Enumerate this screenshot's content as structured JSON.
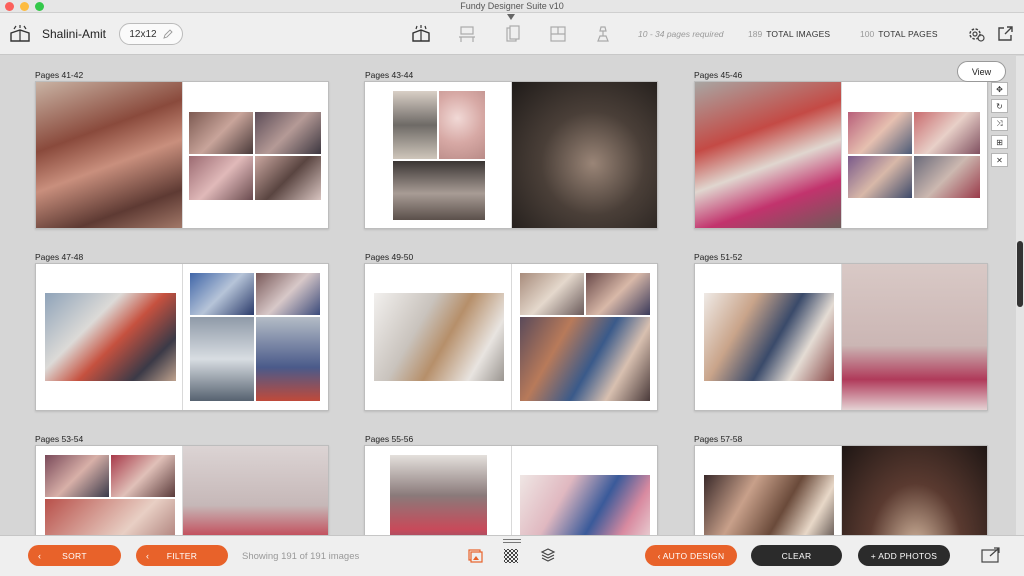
{
  "window": {
    "title": "Fundy Designer Suite v10"
  },
  "toolbar": {
    "project_name": "Shalini-Amit",
    "album_size": "12x12",
    "pages_required": "10 - 34 pages required",
    "total_images_count": "189",
    "total_images_label": "TOTAL IMAGES",
    "total_pages_count": "100",
    "total_pages_label": "TOTAL PAGES"
  },
  "content": {
    "view_button": "View",
    "spreads": [
      {
        "label": "Pages 41-42"
      },
      {
        "label": "Pages 43-44"
      },
      {
        "label": "Pages 45-46"
      },
      {
        "label": "Pages 47-48"
      },
      {
        "label": "Pages 49-50"
      },
      {
        "label": "Pages 51-52"
      },
      {
        "label": "Pages 53-54"
      },
      {
        "label": "Pages 55-56"
      },
      {
        "label": "Pages 57-58"
      }
    ],
    "side_tools": [
      "move-icon",
      "rotate-icon",
      "shuffle-icon",
      "grid-icon",
      "close-icon"
    ]
  },
  "bottombar": {
    "sort_label": "SORT",
    "filter_label": "FILTER",
    "showing_text": "Showing 191 of 191 images",
    "auto_design_label": "AUTO DESIGN",
    "clear_label": "CLEAR",
    "add_photos_label": "+ ADD PHOTOS"
  },
  "colors": {
    "accent": "#e8622a",
    "dark_button": "#2b2b2b",
    "background": "#d6d6d6"
  }
}
